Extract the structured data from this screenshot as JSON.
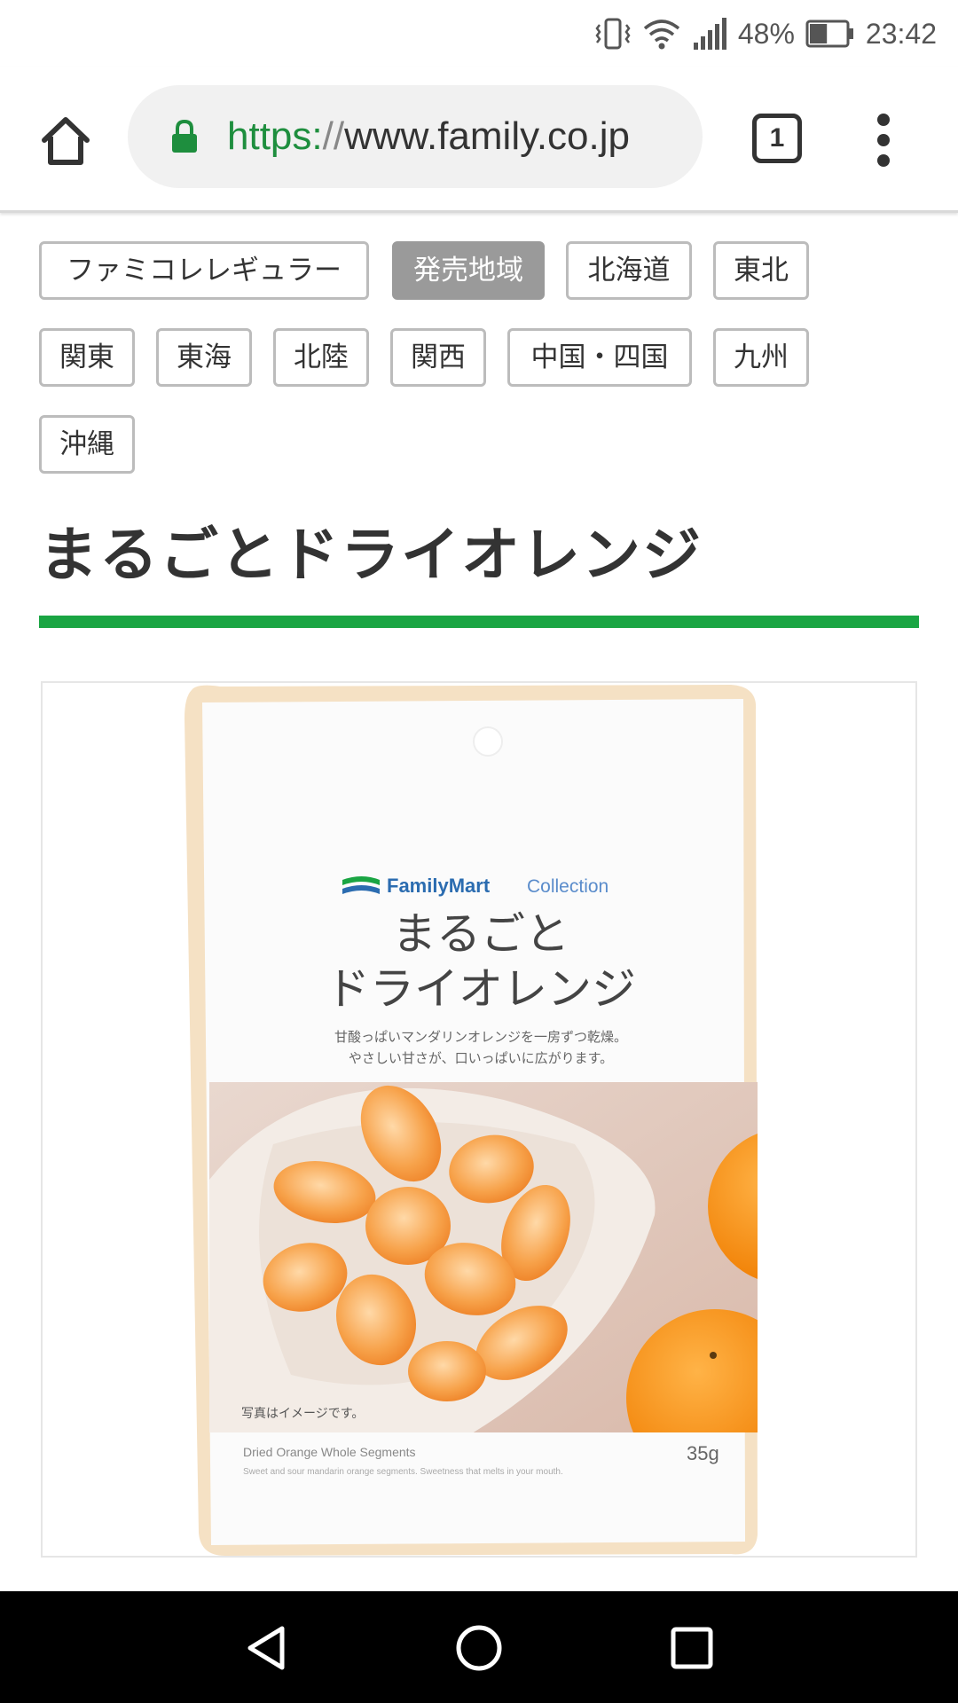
{
  "status_bar": {
    "battery_percent": "48%",
    "time": "23:42",
    "battery_level": 0.48,
    "icons": [
      "vibrate-icon",
      "wifi-icon",
      "signal-icon",
      "battery-icon"
    ]
  },
  "browser": {
    "url_scheme": "https:",
    "url_slashes": "//",
    "url_host": "www.family.co.jp",
    "tab_count": "1",
    "icons": [
      "home-icon",
      "lock-icon",
      "tab-switcher-icon",
      "overflow-menu-icon"
    ]
  },
  "tags": [
    {
      "label": "ファミコレレギュラー",
      "active": false
    },
    {
      "label": "発売地域",
      "active": true
    },
    {
      "label": "北海道",
      "active": false
    },
    {
      "label": "東北",
      "active": false
    },
    {
      "label": "関東",
      "active": false
    },
    {
      "label": "東海",
      "active": false
    },
    {
      "label": "北陸",
      "active": false
    },
    {
      "label": "関西",
      "active": false
    },
    {
      "label": "中国・四国",
      "active": false
    },
    {
      "label": "九州",
      "active": false
    },
    {
      "label": "沖縄",
      "active": false
    }
  ],
  "product": {
    "title": "まるごとドライオレンジ",
    "package": {
      "brand": "FamilyMart",
      "brand_sub": "Collection",
      "name_line1": "まるごと",
      "name_line2": "ドライオレンジ",
      "desc_line1": "甘酸っぱいマンダリンオレンジを一房ずつ乾燥。",
      "desc_line2": "やさしい甘さが、口いっぱいに広がります。",
      "photo_note": "写真はイメージです。",
      "english_name": "Dried Orange   Whole Segments",
      "english_desc": "Sweet and sour mandarin orange segments. Sweetness that melts in your mouth.",
      "weight": "35g"
    }
  },
  "colors": {
    "accent_green": "#1aa543",
    "url_scheme_green": "#1e8e3e",
    "active_tag": "#9a9a9a",
    "brand_blue": "#2b6cb0",
    "orange": "#f58a2c"
  },
  "nav": {
    "icons": [
      "back-icon",
      "home-circle-icon",
      "recents-icon"
    ]
  }
}
